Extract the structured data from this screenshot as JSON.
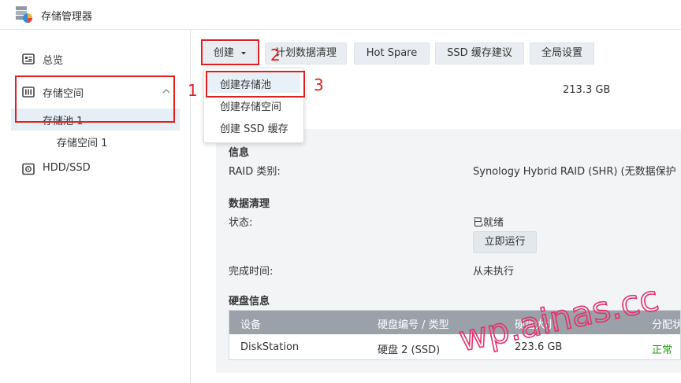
{
  "window": {
    "title": "存储管理器"
  },
  "sidebar": {
    "items": [
      {
        "label": "总览",
        "icon": "overview-icon"
      },
      {
        "label": "存储空间",
        "icon": "storage-icon"
      },
      {
        "label": "存储池 1"
      },
      {
        "label": "存储空间 1"
      },
      {
        "label": "HDD/SSD",
        "icon": "disk-icon"
      }
    ]
  },
  "toolbar": {
    "create_label": "创建",
    "buttons": [
      "计划数据清理",
      "Hot Spare",
      "SSD 缓存建议",
      "全局设置"
    ]
  },
  "dropdown": {
    "items": [
      "创建存储池",
      "创建存储空间",
      "创建 SSD 缓存"
    ]
  },
  "summary": {
    "capacity": "213.3 GB"
  },
  "info": {
    "title": "信息",
    "raid_label": "RAID 类别:",
    "raid_value": "Synology Hybrid RAID (SHR) (无数据保护"
  },
  "scrub": {
    "title": "数据清理",
    "status_label": "状态:",
    "status_value": "已就绪",
    "run_button": "立即运行",
    "done_label": "完成时间:",
    "done_value": "从未执行"
  },
  "disks": {
    "title": "硬盘信息",
    "columns": [
      "设备",
      "硬盘编号 / 类型",
      "硬盘大小",
      "分配状"
    ],
    "rows": [
      {
        "device": "DiskStation",
        "number": "硬盘 2 (SSD)",
        "size": "223.6 GB",
        "status": "正常"
      }
    ]
  },
  "annotations": {
    "one": "1",
    "two": "2",
    "three": "3"
  },
  "watermark": "wp.ainas.cc",
  "colors": {
    "accent": "#0b6fd6",
    "annotation": "#e02020",
    "status_ok": "#2a9a1a",
    "watermark": "#e8306a"
  }
}
